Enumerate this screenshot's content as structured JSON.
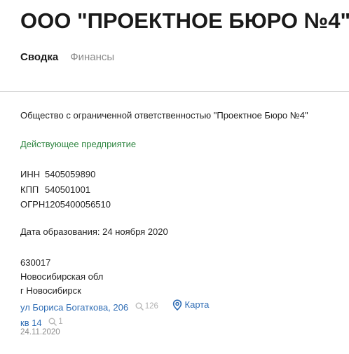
{
  "header": {
    "title": "ООО \"ПРОЕКТНОЕ БЮРО №4\""
  },
  "tabs": [
    {
      "label": "Сводка",
      "active": true
    },
    {
      "label": "Финансы",
      "active": false
    }
  ],
  "company": {
    "full_name": "Общество с ограниченной ответственностью \"Проектное Бюро №4\"",
    "status": "Действующее предприятие",
    "status_color": "#2e8540",
    "codes": [
      {
        "label": "ИНН",
        "value": "5405059890"
      },
      {
        "label": "КПП",
        "value": "540501001"
      },
      {
        "label": "ОГРН",
        "value": "1205400056510"
      }
    ],
    "founded": "Дата образования: 24 ноября 2020"
  },
  "address": {
    "postcode": "630017",
    "region": "Новосибирская обл",
    "city": "г Новосибирск",
    "street": "ул Бориса Богаткова, 206",
    "street_count": "126",
    "map_label": "Карта",
    "apartment": "кв 14",
    "apartment_count": "1",
    "date": "24.11.2020"
  },
  "colors": {
    "link": "#2f6db5",
    "muted": "#8a8a8a"
  }
}
